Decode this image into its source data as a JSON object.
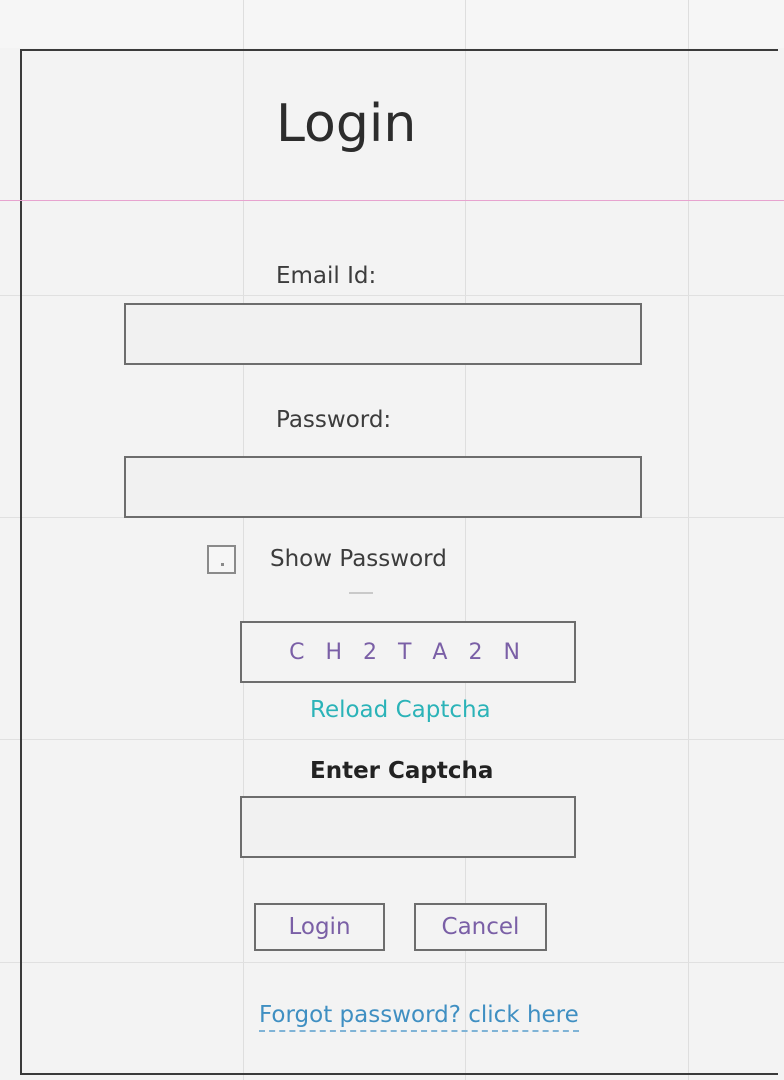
{
  "form": {
    "title": "Login",
    "email_label": "Email Id:",
    "email_value": "",
    "password_label": "Password:",
    "password_value": "",
    "show_password_label": "Show Password",
    "show_password_checked": false,
    "captcha_text": "C H 2 T A 2 N",
    "reload_captcha_label": "Reload Captcha",
    "enter_captcha_label": "Enter Captcha",
    "captcha_value": "",
    "login_button_label": "Login",
    "cancel_button_label": "Cancel",
    "forgot_password_label": "Forgot password?  click here"
  },
  "colors": {
    "accent_purple": "#7a5fa6",
    "link_teal": "#2bb3b8",
    "link_blue": "#3f8fc2",
    "guide_pink": "#e7a3cf"
  }
}
